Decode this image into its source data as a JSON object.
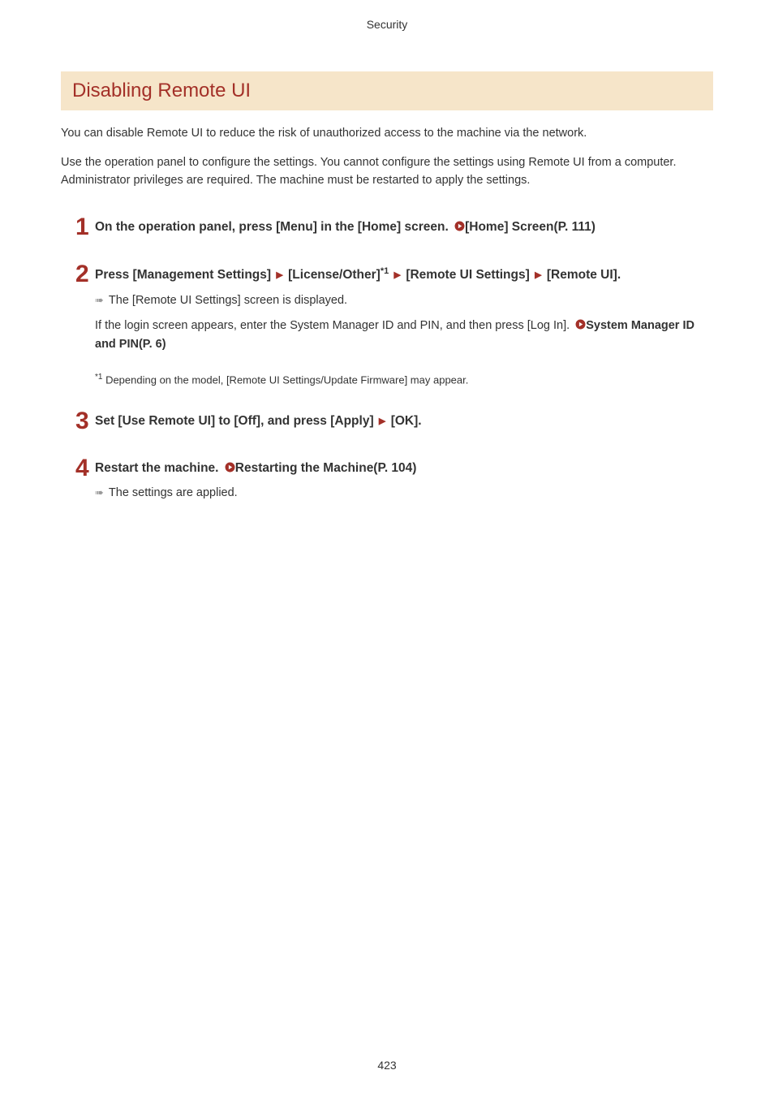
{
  "header": {
    "label": "Security"
  },
  "title": "Disabling Remote UI",
  "intro": {
    "p1": "You can disable Remote UI to reduce the risk of unauthorized access to the machine via the network.",
    "p2": "Use the operation panel to configure the settings. You cannot configure the settings using Remote UI from a computer.",
    "p3": "Administrator privileges are required. The machine must be restarted to apply the settings."
  },
  "steps": {
    "s1": {
      "num": "1",
      "title_a": "On the operation panel, press [Menu] in the [Home] screen. ",
      "link_text": "[Home] Screen(P. 111)"
    },
    "s2": {
      "num": "2",
      "title_a": "Press [Management Settings] ",
      "title_b": " [License/Other]",
      "sup": "*1",
      "title_c": " [Remote UI Settings] ",
      "title_d": " [Remote UI].",
      "bullet": "The [Remote UI Settings] screen is displayed.",
      "note_a": "If the login screen appears, enter the System Manager ID and PIN, and then press [Log In]. ",
      "note_link": "System Manager ID and PIN(P. 6)",
      "footnote_sup": "*1",
      "footnote_text": " Depending on the model, [Remote UI Settings/Update Firmware] may appear."
    },
    "s3": {
      "num": "3",
      "title_a": "Set [Use Remote UI] to [Off], and press [Apply] ",
      "title_b": " [OK]."
    },
    "s4": {
      "num": "4",
      "title_a": "Restart the machine. ",
      "link_text": "Restarting the Machine(P. 104)",
      "bullet": "The settings are applied."
    }
  },
  "page_number": "423"
}
